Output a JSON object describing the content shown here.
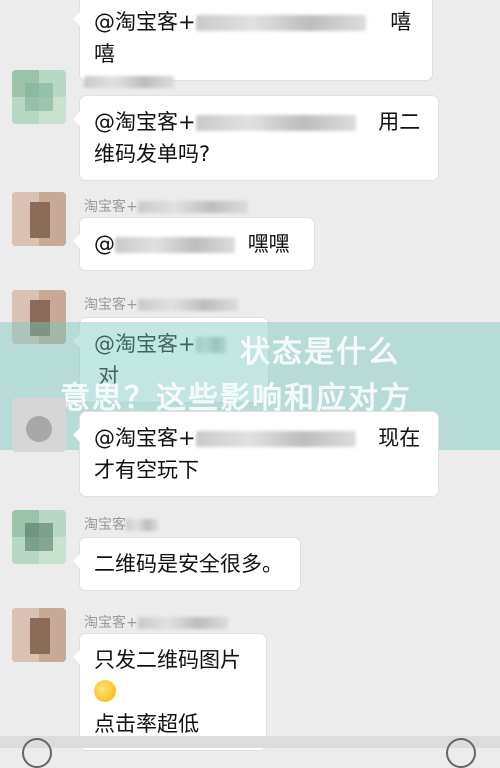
{
  "messages": [
    {
      "sender": "",
      "text_pre": "@淘宝客+",
      "text_post": "嘻嘻",
      "line2": ""
    },
    {
      "sender": "",
      "text_pre": "@淘宝客+",
      "text_post": "用二",
      "line2": "维码发单吗?"
    },
    {
      "sender": "淘宝客+",
      "text_pre": "@",
      "text_post": "嘿嘿",
      "line2": ""
    },
    {
      "sender": "淘宝客+",
      "text_pre": "@淘宝客+",
      "text_post": "对",
      "line2": ""
    },
    {
      "sender": "",
      "text_pre": "@淘宝客+",
      "text_post": "现在",
      "line2": "才有空玩下"
    },
    {
      "sender": "淘宝客",
      "text_pre": "二维码是安全很多。",
      "text_post": "",
      "line2": ""
    },
    {
      "sender": "淘宝客+",
      "text_pre": "只发二维码图片",
      "text_post": "",
      "line2": "点击率超低"
    }
  ],
  "watermark": {
    "line1": "状态是什么",
    "line2": "意思？这些影响和应对方"
  },
  "colors": {
    "watermark_bg": "#78c8be",
    "chat_bg": "#ececec",
    "bubble_bg": "#ffffff"
  }
}
